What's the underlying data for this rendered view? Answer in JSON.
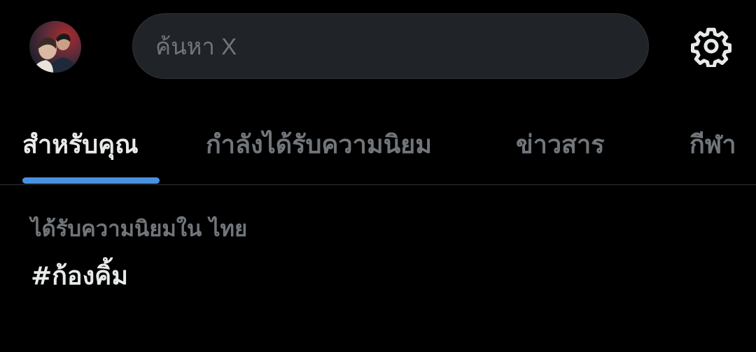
{
  "header": {
    "avatar_icon": "profile-avatar",
    "search": {
      "placeholder": "ค้นหา X"
    },
    "settings_icon": "gear-icon"
  },
  "tabs": [
    {
      "label": "สำหรับคุณ",
      "active": true
    },
    {
      "label": "กำลังได้รับความนิยม",
      "active": false
    },
    {
      "label": "ข่าวสาร",
      "active": false
    },
    {
      "label": "กีฬา",
      "active": false
    }
  ],
  "trend": {
    "context": "ได้รับความนิยมใน ไทย",
    "title": "#ก้องคิ้ม"
  },
  "colors": {
    "background": "#000000",
    "accent": "#4a90e2",
    "muted_text": "#71767b",
    "primary_text": "#e7e9ea",
    "search_bg": "#202327"
  }
}
